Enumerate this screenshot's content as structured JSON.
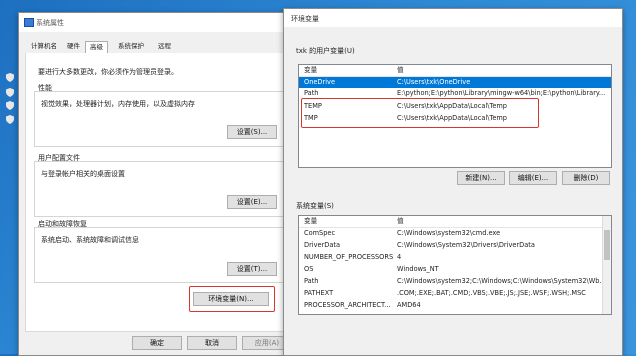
{
  "colors": {
    "accent": "#0078d7",
    "highlight": "#d9362b",
    "desktop": "#2f8ad6"
  },
  "sys_props": {
    "title": "系统属性",
    "tabs": [
      "计算机名",
      "硬件",
      "高级",
      "系统保护",
      "远程"
    ],
    "admin_note": "要进行大多数更改，你必须作为管理员登录。",
    "perf": {
      "title": "性能",
      "desc": "视觉效果，处理器计划，内存使用，以及虚拟内存",
      "button": "设置(S)..."
    },
    "profile": {
      "title": "用户配置文件",
      "desc": "与登录帐户相关的桌面设置",
      "button": "设置(E)..."
    },
    "startup": {
      "title": "启动和故障恢复",
      "desc": "系统启动、系统故障和调试信息",
      "button": "设置(T)..."
    },
    "env_button": "环境变量(N)...",
    "ok": "确定",
    "cancel": "取消",
    "apply": "应用(A)"
  },
  "env": {
    "title": "环境变量",
    "user_section": "txk 的用户变量(U)",
    "col_var": "变量",
    "col_val": "值",
    "user_vars": [
      {
        "name": "OneDrive",
        "value": "C:\\Users\\txk\\OneDrive",
        "selected": true
      },
      {
        "name": "Path",
        "value": "E:\\python;E:\\python\\Library\\mingw-w64\\bin;E:\\python\\Library...",
        "selected": false
      },
      {
        "name": "TEMP",
        "value": "C:\\Users\\txk\\AppData\\Local\\Temp",
        "selected": false
      },
      {
        "name": "TMP",
        "value": "C:\\Users\\txk\\AppData\\Local\\Temp",
        "selected": false
      }
    ],
    "user_buttons": [
      "新建(N)...",
      "编辑(E)...",
      "删除(D)"
    ],
    "sys_section": "系统变量(S)",
    "sys_vars": [
      {
        "name": "ComSpec",
        "value": "C:\\Windows\\system32\\cmd.exe"
      },
      {
        "name": "DriverData",
        "value": "C:\\Windows\\System32\\Drivers\\DriverData"
      },
      {
        "name": "NUMBER_OF_PROCESSORS",
        "value": "4"
      },
      {
        "name": "OS",
        "value": "Windows_NT"
      },
      {
        "name": "Path",
        "value": "C:\\Windows\\system32;C:\\Windows;C:\\Windows\\System32\\Wb..."
      },
      {
        "name": "PATHEXT",
        "value": ".COM;.EXE;.BAT;.CMD;.VBS;.VBE;.JS;.JSE;.WSF;.WSH;.MSC"
      },
      {
        "name": "PROCESSOR_ARCHITECT...",
        "value": "AMD64"
      }
    ]
  }
}
